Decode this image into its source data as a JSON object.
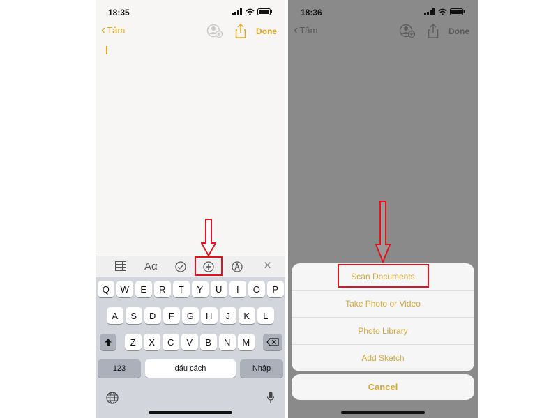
{
  "left_screen": {
    "status": {
      "time": "18:35"
    },
    "nav": {
      "back_label": "Tâm",
      "done_label": "Done"
    },
    "toolbar": {
      "format_label": "Aα",
      "close_glyph": "×"
    },
    "keyboard": {
      "row1": [
        "Q",
        "W",
        "E",
        "R",
        "T",
        "Y",
        "U",
        "I",
        "O",
        "P"
      ],
      "row2": [
        "A",
        "S",
        "D",
        "F",
        "G",
        "H",
        "J",
        "K",
        "L"
      ],
      "row3": [
        "Z",
        "X",
        "C",
        "V",
        "B",
        "N",
        "M"
      ],
      "numbers_key": "123",
      "space_key": "dấu cách",
      "return_key": "Nhập"
    }
  },
  "right_screen": {
    "status": {
      "time": "18:36"
    },
    "nav": {
      "back_label": "Tâm",
      "done_label": "Done"
    },
    "action_sheet": {
      "items": [
        "Scan Documents",
        "Take Photo or Video",
        "Photo Library",
        "Add Sketch"
      ],
      "cancel_label": "Cancel"
    }
  },
  "colors": {
    "accent": "#e3a821",
    "highlight": "#e0141e",
    "dim_overlay": "#8a8a8a"
  }
}
